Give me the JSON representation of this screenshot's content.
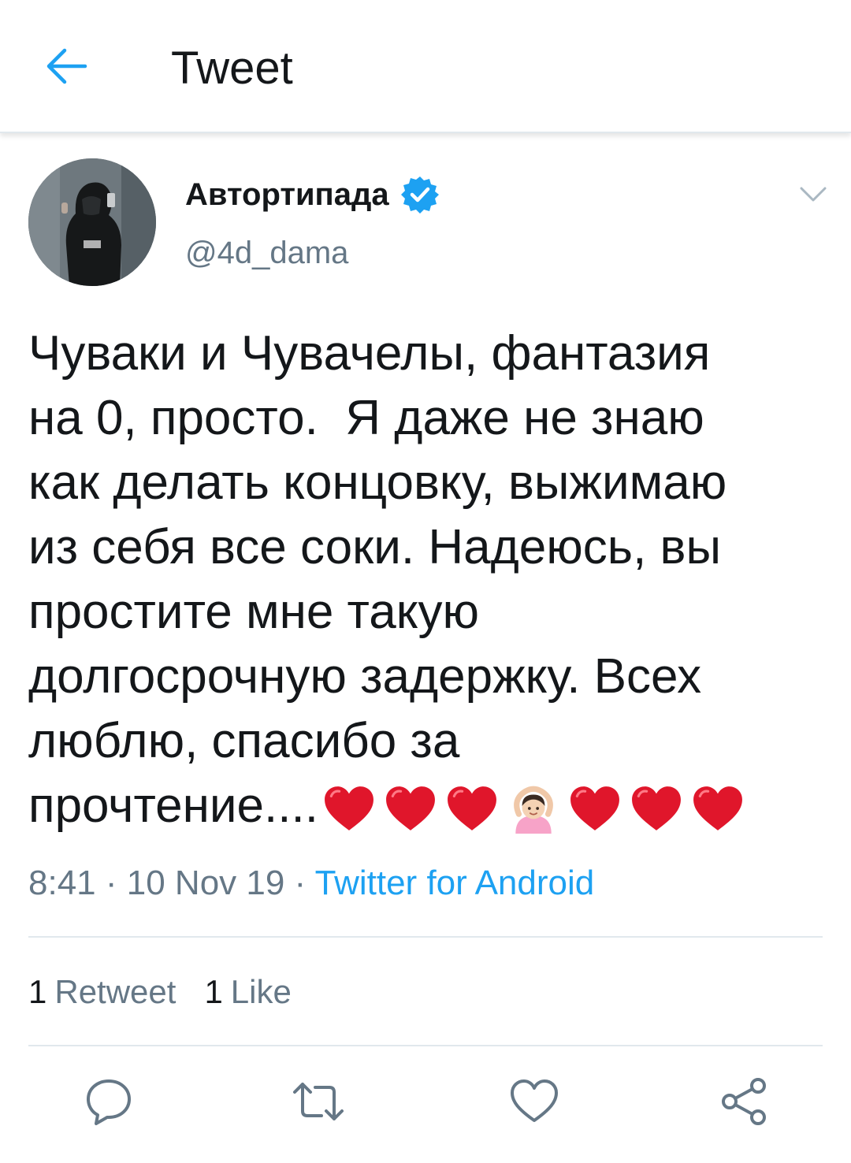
{
  "header": {
    "title": "Tweet"
  },
  "author": {
    "name": "Автортипада",
    "handle": "@4d_dama"
  },
  "tweet": {
    "text": "Чуваки и Чувачелы, фантазия\nна 0, просто.  Я даже не знаю\nкак делать концовку, выжимаю\nиз себя все соки. Надеюсь, вы\nпростите мне такую\nдолгосрочную задержку. Всех\nлюблю, спасибо за\nпрочтение....",
    "emojis": [
      "heart-emoji",
      "heart-emoji",
      "heart-emoji",
      "person-gesturing-ok-emoji",
      "heart-emoji",
      "heart-emoji",
      "heart-emoji"
    ]
  },
  "meta": {
    "time": "8:41",
    "sep1": " · ",
    "date": "10 Nov 19",
    "sep2": " · ",
    "source": "Twitter for Android"
  },
  "stats": {
    "retweets_count": "1",
    "retweets_label": "Retweet",
    "likes_count": "1",
    "likes_label": "Like"
  },
  "actions": [
    "reply-icon",
    "retweet-icon",
    "like-icon",
    "share-icon"
  ],
  "colors": {
    "accent": "#1da1f2",
    "text": "#14171a",
    "muted": "#657786",
    "divider": "#e1e8ed",
    "heart": "#e0162b"
  }
}
